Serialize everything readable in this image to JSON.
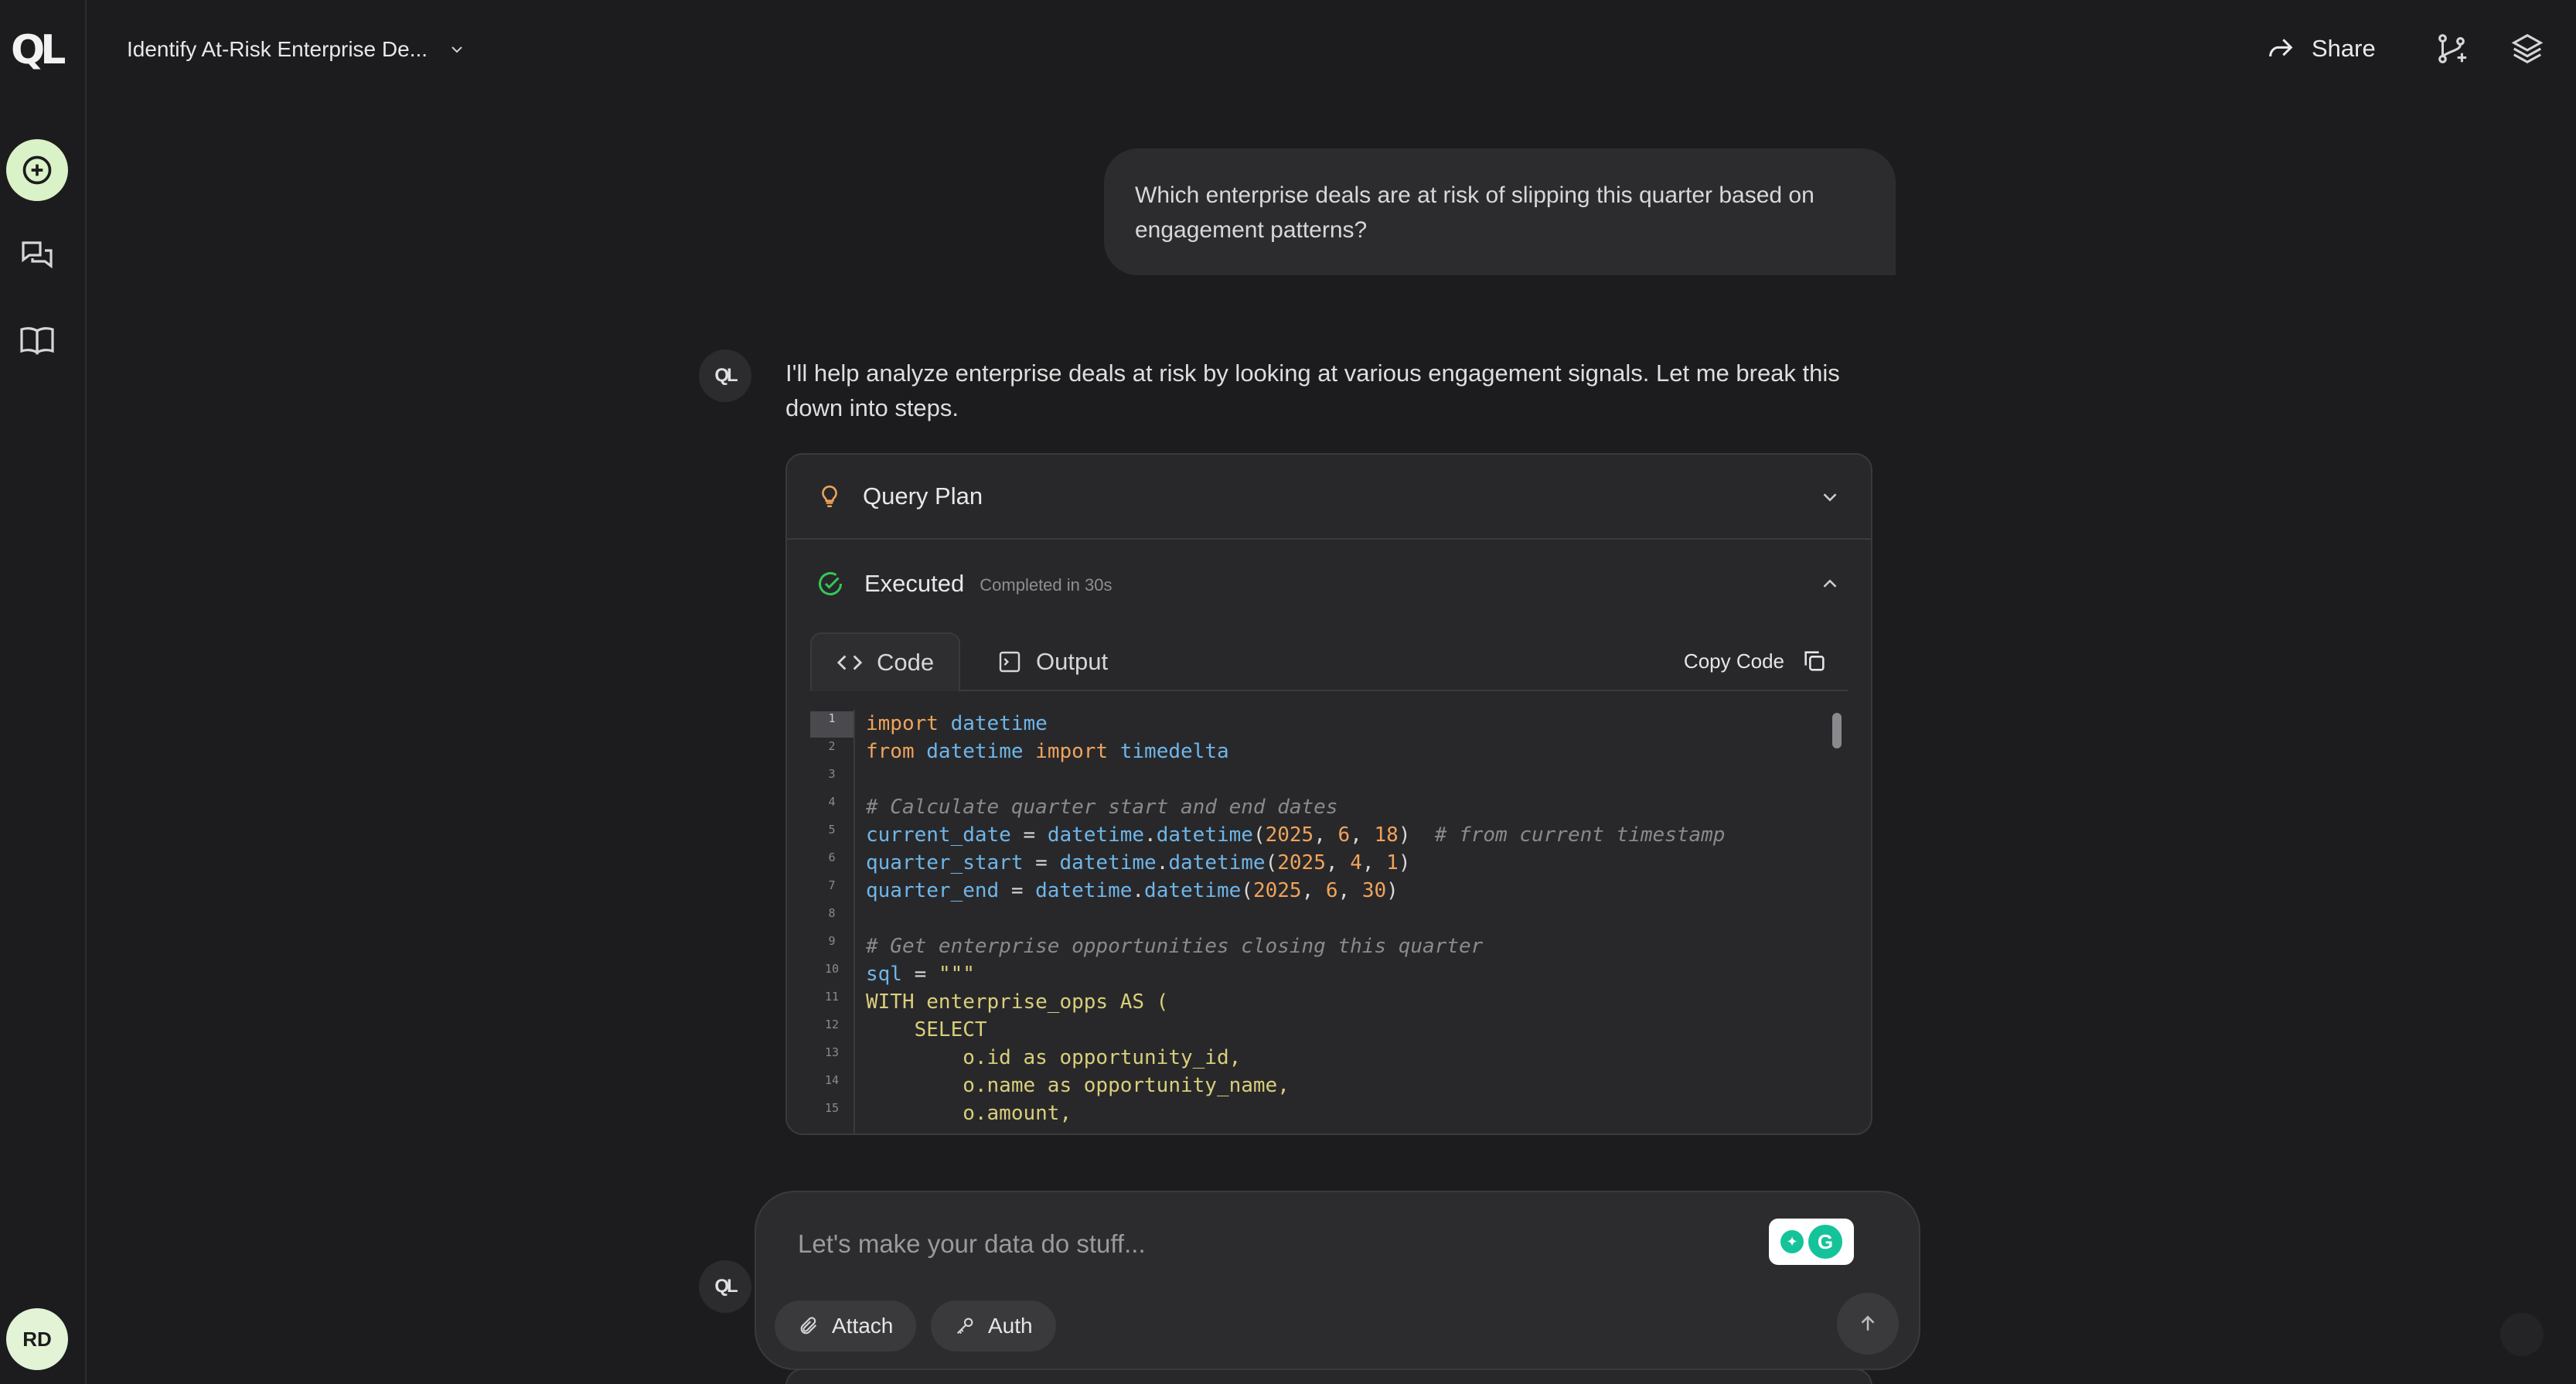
{
  "app": {
    "logo_text": "QL"
  },
  "header": {
    "conversation_title": "Identify At-Risk Enterprise De...",
    "share_label": "Share"
  },
  "sidebar": {
    "items": [
      {
        "icon": "plus-circle-icon"
      },
      {
        "icon": "chat-bubbles-icon"
      },
      {
        "icon": "book-icon"
      }
    ],
    "avatar_initials": "RD"
  },
  "chat": {
    "user_message": "Which enterprise deals are at risk of slipping this quarter based on engagement patterns?",
    "bot_avatar_text": "QL",
    "bot_message": "I'll help analyze enterprise deals at risk by looking at various engagement signals. Let me break this down into steps."
  },
  "card": {
    "query_plan_label": "Query Plan",
    "executed_label": "Executed",
    "executed_status": "Completed in 30s",
    "tabs": {
      "code": "Code",
      "output": "Output"
    },
    "copy_code_label": "Copy Code",
    "line_numbers": [
      "1",
      "2",
      "3",
      "4",
      "5",
      "6",
      "7",
      "8",
      "9",
      "10",
      "11",
      "12",
      "13",
      "14",
      "15"
    ],
    "code": {
      "l1_kw": "import",
      "l1_id": "datetime",
      "l2_kw1": "from",
      "l2_id1": "datetime",
      "l2_kw2": "import",
      "l2_id2": "timedelta",
      "l4_cm": "# Calculate quarter start and end dates",
      "l5_var": "current_date",
      "l5_eq": " = ",
      "l5_mod": "datetime",
      "l5_dot": ".",
      "l5_fn": "datetime",
      "l5_open": "(",
      "l5_a": "2025",
      "l5_c1": ", ",
      "l5_b": "6",
      "l5_c2": ", ",
      "l5_c": "18",
      "l5_close": ")",
      "l5_cm": "  # from current timestamp",
      "l6_var": "quarter_start",
      "l6_eq": " = ",
      "l6_mod": "datetime",
      "l6_dot": ".",
      "l6_fn": "datetime",
      "l6_open": "(",
      "l6_a": "2025",
      "l6_c1": ", ",
      "l6_b": "4",
      "l6_c2": ", ",
      "l6_c": "1",
      "l6_close": ")",
      "l7_var": "quarter_end",
      "l7_eq": " = ",
      "l7_mod": "datetime",
      "l7_dot": ".",
      "l7_fn": "datetime",
      "l7_open": "(",
      "l7_a": "2025",
      "l7_c1": ", ",
      "l7_b": "6",
      "l7_c2": ", ",
      "l7_c": "30",
      "l7_close": ")",
      "l9_cm": "# Get enterprise opportunities closing this quarter",
      "l10_var": "sql",
      "l10_eq": " = ",
      "l10_str": "\"\"\"",
      "l11": "WITH enterprise_opps AS (",
      "l12": "    SELECT",
      "l13": "        o.id as opportunity_id,",
      "l14": "        o.name as opportunity_name,",
      "l15": "        o.amount,"
    }
  },
  "composer": {
    "placeholder": "Let's make your data do stuff...",
    "attach_label": "Attach",
    "auth_label": "Auth"
  },
  "colors": {
    "background": "#1c1c1e",
    "accent_green": "#d9f2c8",
    "success": "#34c759",
    "keyword": "#f0a35a",
    "identifier": "#6fb6e8"
  }
}
